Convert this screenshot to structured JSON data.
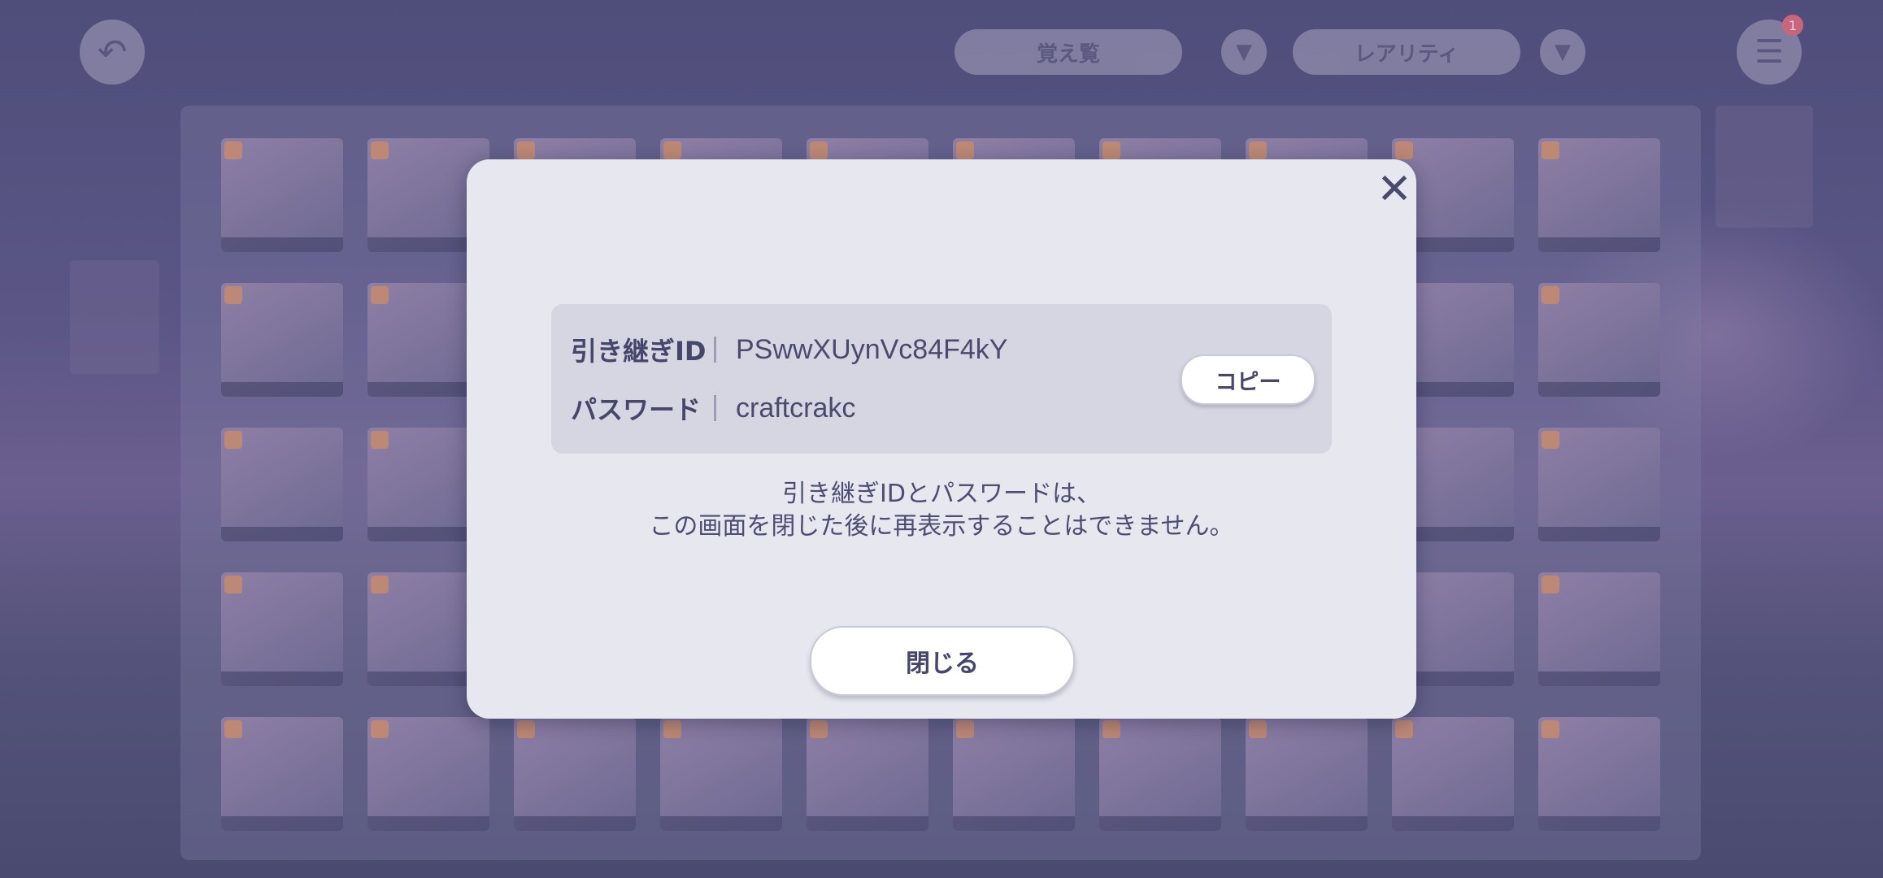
{
  "background": {
    "sort_label": "覚え覧",
    "rarity_label": "レアリティ",
    "menu_badge": "1",
    "icons": {
      "back": "undo-arrow-icon",
      "filter": "funnel-icon",
      "order": "triangle-down-icon",
      "menu": "hamburger-menu-icon"
    }
  },
  "dialog": {
    "id_label": "引き継ぎID",
    "id_value": "PSwwXUynVc84F4kY",
    "password_label": "パスワード",
    "password_value": "craftcrakc",
    "copy_label": "コピー",
    "notice_line1": "引き継ぎIDとパスワードは、",
    "notice_line2": "この画面を閉じた後に再表示することはできません。",
    "close_label": "閉じる",
    "close_icon": "close-x-icon"
  },
  "colors": {
    "dialog_bg": "#e6e7ef",
    "info_box_bg": "#d6d6e2",
    "text_primary": "#46466a",
    "overlay": "#4f4d7a"
  }
}
